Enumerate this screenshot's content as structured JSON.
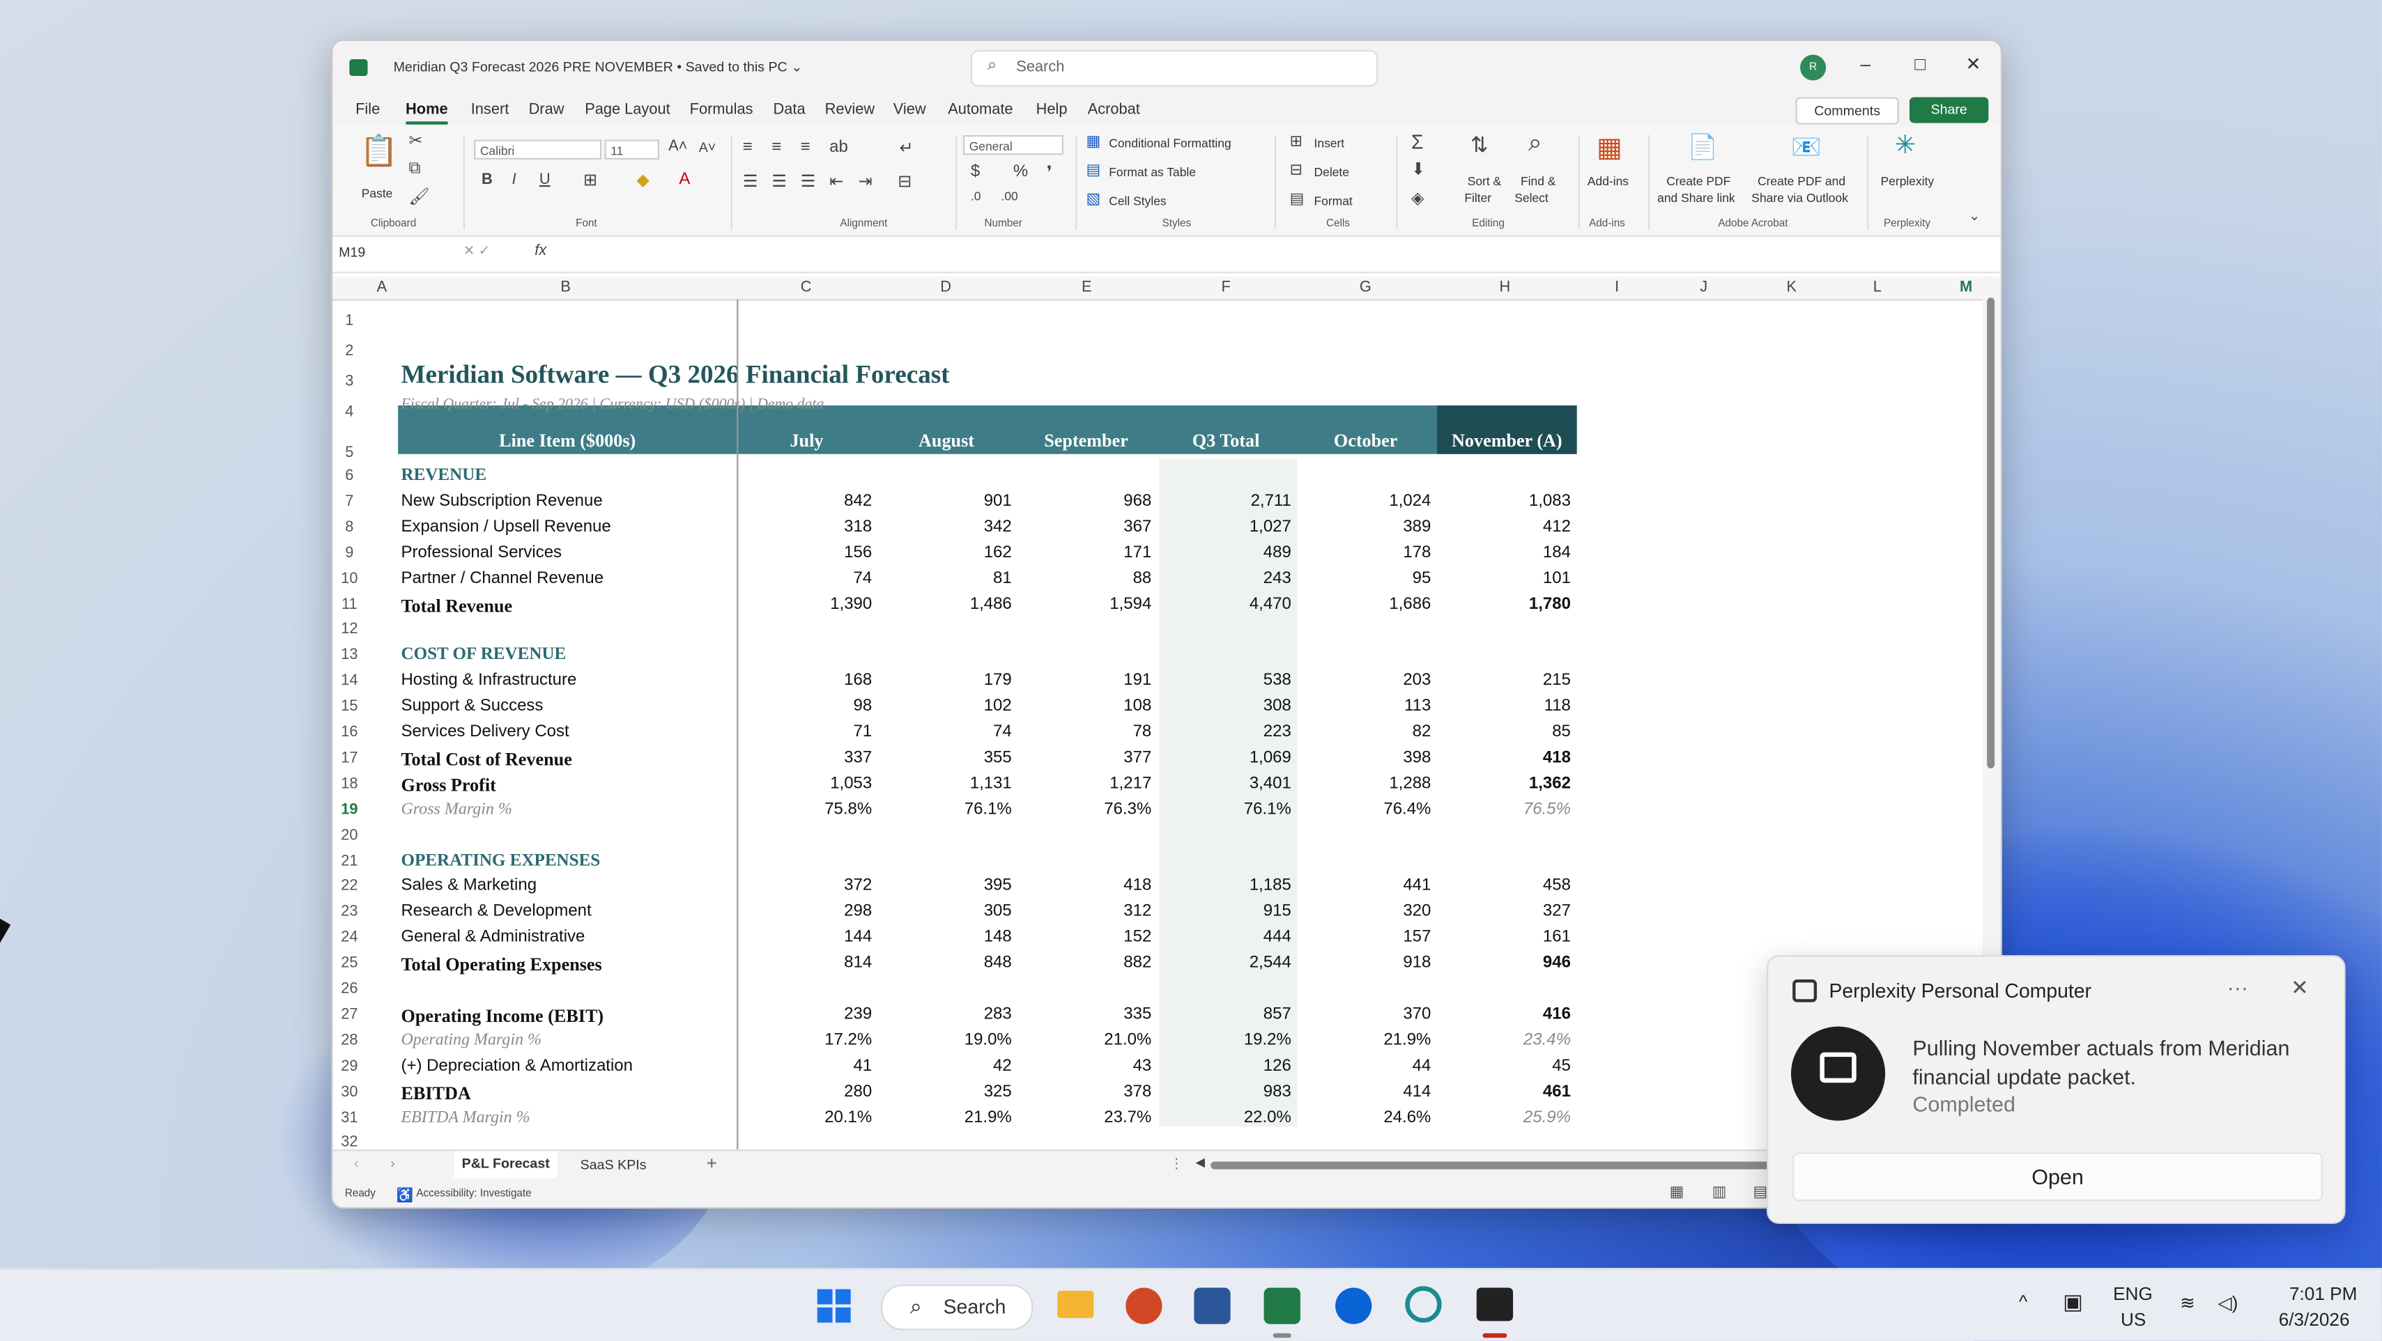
{
  "window": {
    "doc_title": "Meridian Q3 Forecast 2026 PRE NOVEMBER • Saved to this PC ⌄",
    "search_placeholder": "Search",
    "avatar": "R",
    "controls": {
      "minimize": "–",
      "maximize": "□",
      "close": "✕"
    }
  },
  "menu": {
    "items": [
      "File",
      "Home",
      "Insert",
      "Draw",
      "Page Layout",
      "Formulas",
      "Data",
      "Review",
      "View",
      "Automate",
      "Help",
      "Acrobat"
    ],
    "active": "Home",
    "comments": "Comments",
    "share": "Share"
  },
  "ribbon": {
    "paste": "Paste",
    "font_name": "Calibri",
    "font_size": "11",
    "number_format": "General",
    "conditional_formatting": "Conditional Formatting",
    "format_as_table": "Format as Table",
    "cell_styles": "Cell Styles",
    "insert": "Insert",
    "delete": "Delete",
    "format": "Format",
    "sort_filter": "Sort &",
    "sort_filter2": "Filter",
    "find_select": "Find &",
    "find_select2": "Select",
    "addins": "Add-ins",
    "create_pdf_share": "Create PDF",
    "create_pdf_share2": "and Share link",
    "create_pdf_outlook": "Create PDF and",
    "create_pdf_outlook2": "Share via Outlook",
    "perplexity": "Perplexity",
    "groups": {
      "clipboard": "Clipboard",
      "font": "Font",
      "alignment": "Alignment",
      "number": "Number",
      "styles": "Styles",
      "cells": "Cells",
      "editing": "Editing",
      "addins": "Add-ins",
      "adobe": "Adobe Acrobat",
      "perplexity": "Perplexity"
    }
  },
  "formula_bar": {
    "name_box": "M19",
    "fx": "fx",
    "value": ""
  },
  "columns": [
    "A",
    "B",
    "C",
    "D",
    "E",
    "F",
    "G",
    "H",
    "I",
    "J",
    "K",
    "L",
    "M"
  ],
  "sheet": {
    "title": "Meridian Software — Q3 2026 Financial Forecast",
    "subtitle": "Fiscal Quarter: Jul - Sep 2026  |  Currency: USD ($000s)  |  Demo data",
    "header": [
      "Line Item ($000s)",
      "July",
      "August",
      "September",
      "Q3 Total",
      "October",
      "November (A)"
    ],
    "rows": [
      {
        "n": "1",
        "label": "",
        "style": "blank",
        "v": []
      },
      {
        "n": "2",
        "label": "",
        "style": "blank",
        "v": []
      },
      {
        "n": "3",
        "label": "",
        "style": "blank",
        "v": []
      },
      {
        "n": "4",
        "label": "",
        "style": "blank",
        "v": []
      },
      {
        "n": "5",
        "label": "",
        "style": "blank",
        "v": []
      },
      {
        "n": "6",
        "label": "REVENUE",
        "style": "section",
        "v": []
      },
      {
        "n": "7",
        "label": "New Subscription Revenue",
        "style": "normal",
        "v": [
          "842",
          "901",
          "968",
          "2,711",
          "1,024",
          "1,083"
        ]
      },
      {
        "n": "8",
        "label": "Expansion / Upsell Revenue",
        "style": "normal",
        "v": [
          "318",
          "342",
          "367",
          "1,027",
          "389",
          "412"
        ]
      },
      {
        "n": "9",
        "label": "Professional Services",
        "style": "normal",
        "v": [
          "156",
          "162",
          "171",
          "489",
          "178",
          "184"
        ]
      },
      {
        "n": "10",
        "label": "Partner / Channel Revenue",
        "style": "normal",
        "v": [
          "74",
          "81",
          "88",
          "243",
          "95",
          "101"
        ]
      },
      {
        "n": "11",
        "label": "Total Revenue",
        "style": "total",
        "v": [
          "1,390",
          "1,486",
          "1,594",
          "4,470",
          "1,686",
          "1,780"
        ]
      },
      {
        "n": "12",
        "label": "",
        "style": "blank",
        "v": []
      },
      {
        "n": "13",
        "label": "COST OF REVENUE",
        "style": "section",
        "v": []
      },
      {
        "n": "14",
        "label": "Hosting & Infrastructure",
        "style": "normal",
        "v": [
          "168",
          "179",
          "191",
          "538",
          "203",
          "215"
        ]
      },
      {
        "n": "15",
        "label": "Support & Success",
        "style": "normal",
        "v": [
          "98",
          "102",
          "108",
          "308",
          "113",
          "118"
        ]
      },
      {
        "n": "16",
        "label": "Services Delivery Cost",
        "style": "normal",
        "v": [
          "71",
          "74",
          "78",
          "223",
          "82",
          "85"
        ]
      },
      {
        "n": "17",
        "label": "Total Cost of Revenue",
        "style": "total",
        "v": [
          "337",
          "355",
          "377",
          "1,069",
          "398",
          "418"
        ]
      },
      {
        "n": "18",
        "label": "Gross Profit",
        "style": "total",
        "v": [
          "1,053",
          "1,131",
          "1,217",
          "3,401",
          "1,288",
          "1,362"
        ]
      },
      {
        "n": "19",
        "label": "Gross Margin %",
        "style": "pct",
        "v": [
          "75.8%",
          "76.1%",
          "76.3%",
          "76.1%",
          "76.4%",
          "76.5%"
        ]
      },
      {
        "n": "20",
        "label": "",
        "style": "blank",
        "v": []
      },
      {
        "n": "21",
        "label": "OPERATING EXPENSES",
        "style": "section",
        "v": []
      },
      {
        "n": "22",
        "label": "Sales & Marketing",
        "style": "normal",
        "v": [
          "372",
          "395",
          "418",
          "1,185",
          "441",
          "458"
        ]
      },
      {
        "n": "23",
        "label": "Research & Development",
        "style": "normal",
        "v": [
          "298",
          "305",
          "312",
          "915",
          "320",
          "327"
        ]
      },
      {
        "n": "24",
        "label": "General & Administrative",
        "style": "normal",
        "v": [
          "144",
          "148",
          "152",
          "444",
          "157",
          "161"
        ]
      },
      {
        "n": "25",
        "label": "Total Operating Expenses",
        "style": "total",
        "v": [
          "814",
          "848",
          "882",
          "2,544",
          "918",
          "946"
        ]
      },
      {
        "n": "26",
        "label": "",
        "style": "blank",
        "v": []
      },
      {
        "n": "27",
        "label": "Operating Income (EBIT)",
        "style": "total",
        "v": [
          "239",
          "283",
          "335",
          "857",
          "370",
          "416"
        ]
      },
      {
        "n": "28",
        "label": "Operating Margin %",
        "style": "pct",
        "v": [
          "17.2%",
          "19.0%",
          "21.0%",
          "19.2%",
          "21.9%",
          "23.4%"
        ]
      },
      {
        "n": "29",
        "label": "(+) Depreciation & Amortization",
        "style": "normal",
        "v": [
          "41",
          "42",
          "43",
          "126",
          "44",
          "45"
        ]
      },
      {
        "n": "30",
        "label": "EBITDA",
        "style": "total",
        "v": [
          "280",
          "325",
          "378",
          "983",
          "414",
          "461"
        ]
      },
      {
        "n": "31",
        "label": "EBITDA Margin %",
        "style": "pct",
        "v": [
          "20.1%",
          "21.9%",
          "23.7%",
          "22.0%",
          "24.6%",
          "25.9%"
        ]
      },
      {
        "n": "32",
        "label": "",
        "style": "blank",
        "v": []
      }
    ]
  },
  "sheet_tabs": [
    "P&L Forecast",
    "SaaS KPIs"
  ],
  "add_sheet": "+",
  "status": {
    "ready": "Ready",
    "accessibility": "Accessibility: Investigate"
  },
  "toast": {
    "app": "Perplexity Personal Computer",
    "menu": "···",
    "close": "✕",
    "message": "Pulling November actuals from Meridian financial update packet.",
    "status": "Completed",
    "open": "Open"
  },
  "taskbar": {
    "search": "Search",
    "lang1": "ENG",
    "lang2": "US",
    "time": "7:01 PM",
    "date": "6/3/2026"
  },
  "colors": {
    "excel_green": "#1f7a45",
    "header_teal": "#3e7d87",
    "header_dark": "#1e4d54",
    "section_teal": "#2b6a72"
  }
}
